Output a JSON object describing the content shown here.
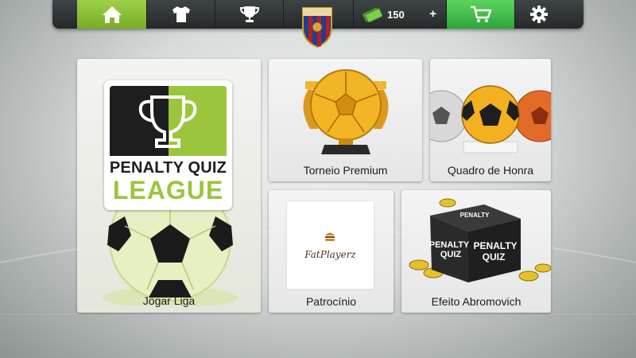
{
  "topbar": {
    "icons": [
      "home-icon",
      "shirt-icon",
      "trophy-icon",
      "team-crest",
      "money-icon",
      "cart-icon",
      "gear-icon"
    ],
    "coins": "150",
    "add_label": "+",
    "active_color": "#8cc63f",
    "cart_color": "#3cb84a"
  },
  "cards": {
    "liga": {
      "label": "Jogar Liga",
      "logo_line1": "PENALTY QUIZ",
      "logo_line2": "LEAGUE"
    },
    "torneio": {
      "label": "Torneio Premium"
    },
    "quadro": {
      "label": "Quadro de Honra"
    },
    "patrocinio": {
      "label": "Patrocínio",
      "sponsor": "FatPlayerz"
    },
    "efeito": {
      "label": "Efeito Abromovich",
      "box_text_line1": "PENALTY",
      "box_text_line2": "QUIZ"
    }
  }
}
